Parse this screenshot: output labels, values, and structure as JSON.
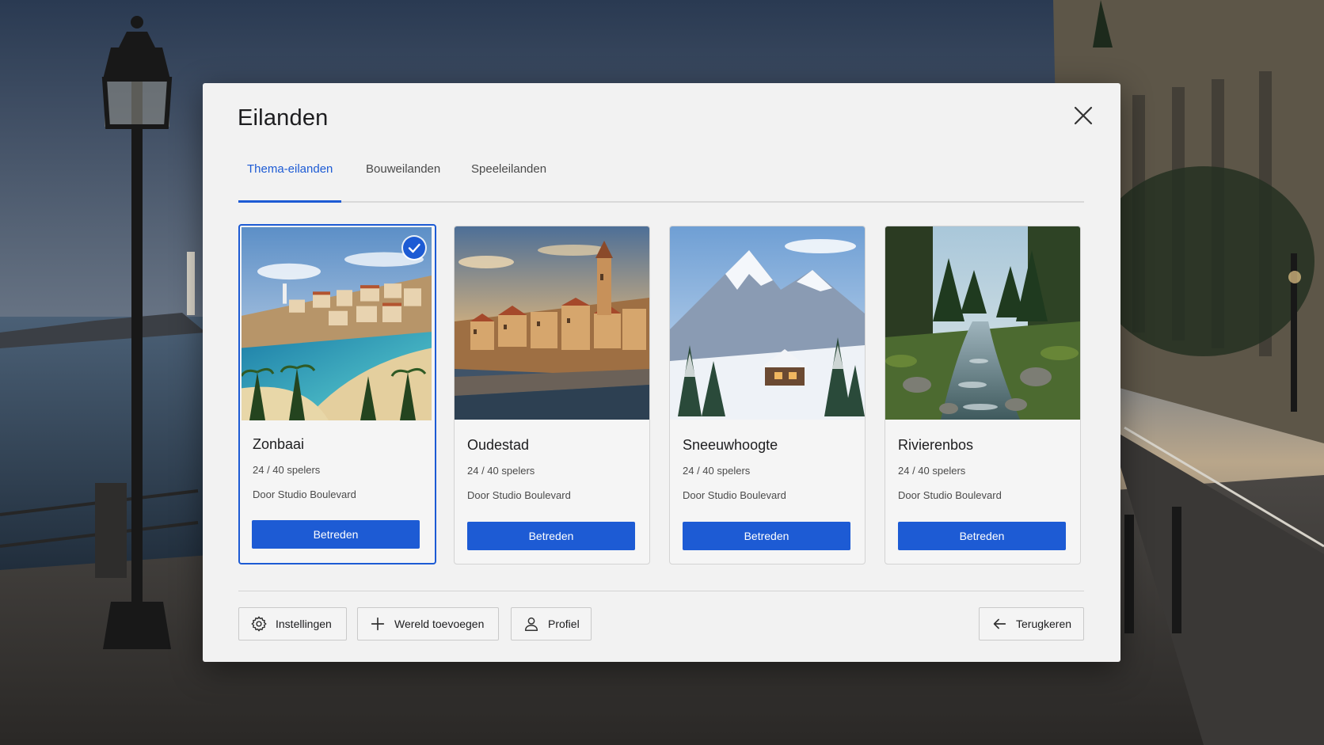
{
  "modal": {
    "title": "Eilanden",
    "close_icon": "close-icon"
  },
  "tabs": [
    {
      "label": "Thema-eilanden",
      "active": true
    },
    {
      "label": "Bouweilanden",
      "active": false
    },
    {
      "label": "Speeleilanden",
      "active": false
    }
  ],
  "cards": [
    {
      "name": "Zonbaai",
      "players": "24 / 40 spelers",
      "author": "Door Studio Boulevard",
      "button": "Betreden",
      "selected": true,
      "scene": "coastal-town"
    },
    {
      "name": "Oudestad",
      "players": "24 / 40 spelers",
      "author": "Door Studio Boulevard",
      "button": "Betreden",
      "selected": false,
      "scene": "old-town"
    },
    {
      "name": "Sneeuwhoogte",
      "players": "24 / 40 spelers",
      "author": "Door Studio Boulevard",
      "button": "Betreden",
      "selected": false,
      "scene": "snowy-mountains"
    },
    {
      "name": "Rivierenbos",
      "players": "24 / 40 spelers",
      "author": "Door Studio Boulevard",
      "button": "Betreden",
      "selected": false,
      "scene": "forest-river"
    }
  ],
  "footer": {
    "settings": {
      "label": "Instellingen",
      "icon": "gear-icon"
    },
    "add_world": {
      "label": "Wereld toevoegen",
      "icon": "plus-icon"
    },
    "profile": {
      "label": "Profiel",
      "icon": "user-icon"
    },
    "back": {
      "label": "Terugkeren",
      "icon": "arrow-left-icon"
    }
  },
  "colors": {
    "accent": "#1d5bd4",
    "panel": "#f2f2f2"
  }
}
